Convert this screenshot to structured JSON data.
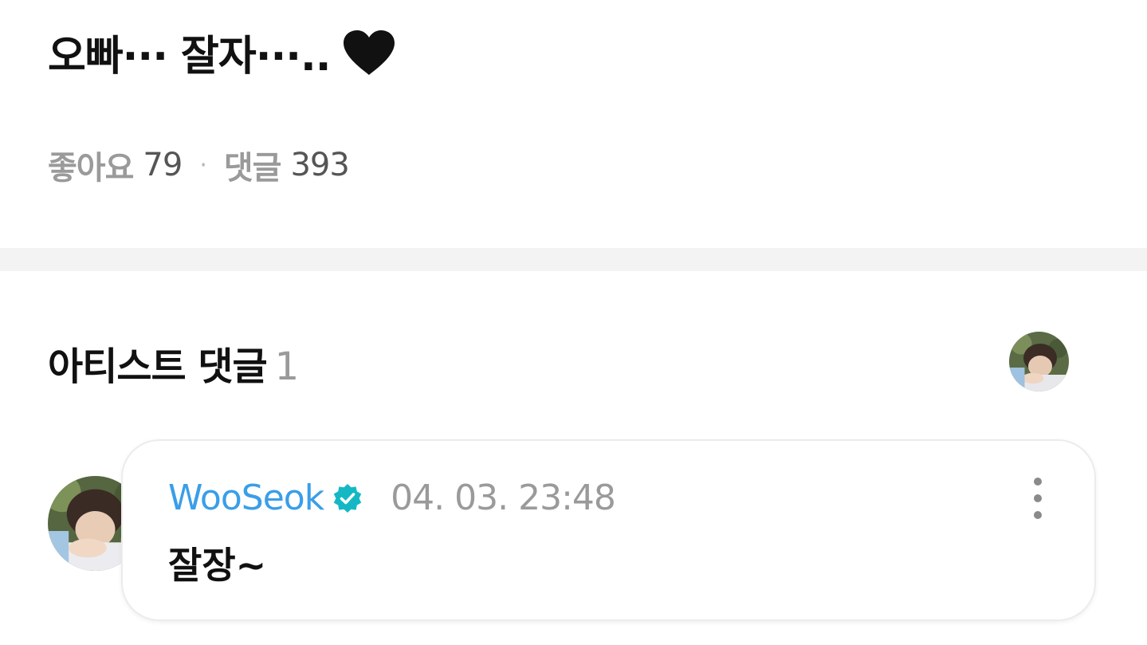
{
  "post": {
    "title": "오빠··· 잘자···..",
    "heart_icon": "black-heart-icon"
  },
  "stats": {
    "likes_label": "좋아요",
    "likes_count": "79",
    "separator": "·",
    "comments_label": "댓글",
    "comments_count": "393"
  },
  "artist_comments": {
    "header_label": "아티스트 댓글",
    "header_count": "1"
  },
  "comment": {
    "author": "WooSeok",
    "verified_icon": "verified-badge-icon",
    "timestamp": "04. 03. 23:48",
    "text": "잘장~",
    "more_icon": "more-vertical-icon"
  },
  "colors": {
    "author": "#3a9ee8",
    "verified": "#14b8c4",
    "divider": "#f3f3f3",
    "muted": "#9a9a9a"
  }
}
